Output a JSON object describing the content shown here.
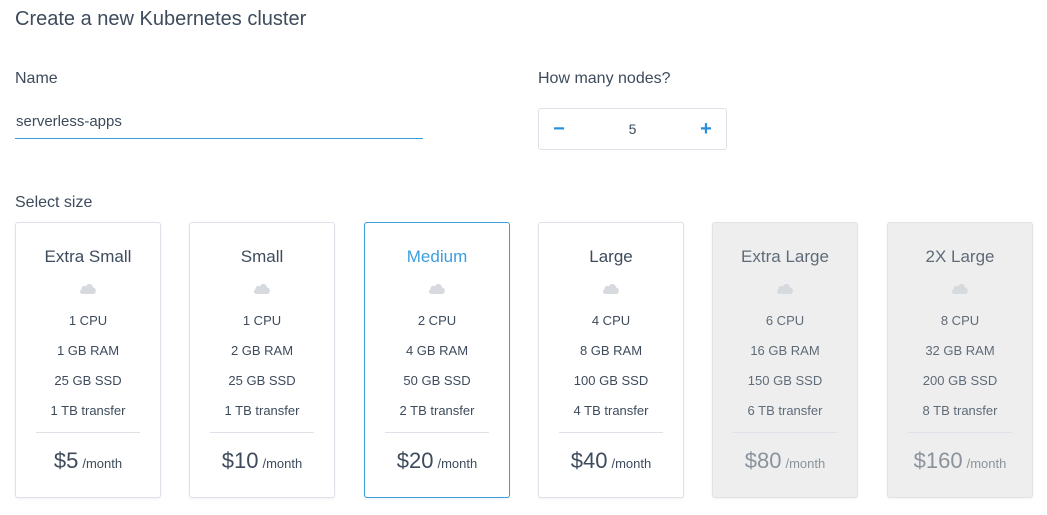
{
  "page": {
    "title": "Create a new Kubernetes cluster"
  },
  "name_field": {
    "label": "Name",
    "value": "serverless-apps"
  },
  "nodes": {
    "label": "How many nodes?",
    "minus": "−",
    "plus": "+",
    "value": "5"
  },
  "sizes": {
    "label": "Select size",
    "cards": [
      {
        "name": "Extra Small",
        "cpu": "1 CPU",
        "ram": "1 GB RAM",
        "ssd": "25 GB SSD",
        "transfer": "1 TB transfer",
        "price": "$5",
        "per": "/month",
        "state": "normal"
      },
      {
        "name": "Small",
        "cpu": "1 CPU",
        "ram": "2 GB RAM",
        "ssd": "25 GB SSD",
        "transfer": "1 TB transfer",
        "price": "$10",
        "per": "/month",
        "state": "normal"
      },
      {
        "name": "Medium",
        "cpu": "2 CPU",
        "ram": "4 GB RAM",
        "ssd": "50 GB SSD",
        "transfer": "2 TB transfer",
        "price": "$20",
        "per": "/month",
        "state": "selected"
      },
      {
        "name": "Large",
        "cpu": "4 CPU",
        "ram": "8 GB RAM",
        "ssd": "100 GB SSD",
        "transfer": "4 TB transfer",
        "price": "$40",
        "per": "/month",
        "state": "normal"
      },
      {
        "name": "Extra Large",
        "cpu": "6 CPU",
        "ram": "16 GB RAM",
        "ssd": "150 GB SSD",
        "transfer": "6 TB transfer",
        "price": "$80",
        "per": "/month",
        "state": "disabled"
      },
      {
        "name": "2X Large",
        "cpu": "8 CPU",
        "ram": "32 GB RAM",
        "ssd": "200 GB SSD",
        "transfer": "8 TB transfer",
        "price": "$160",
        "per": "/month",
        "state": "disabled"
      }
    ]
  },
  "colors": {
    "accent": "#3b9ede",
    "stepper": "#2a8fd8",
    "text": "#3d4b5c",
    "disabled_bg": "#eeeeee"
  },
  "icons": {
    "card_icon": "cloud-icon"
  }
}
